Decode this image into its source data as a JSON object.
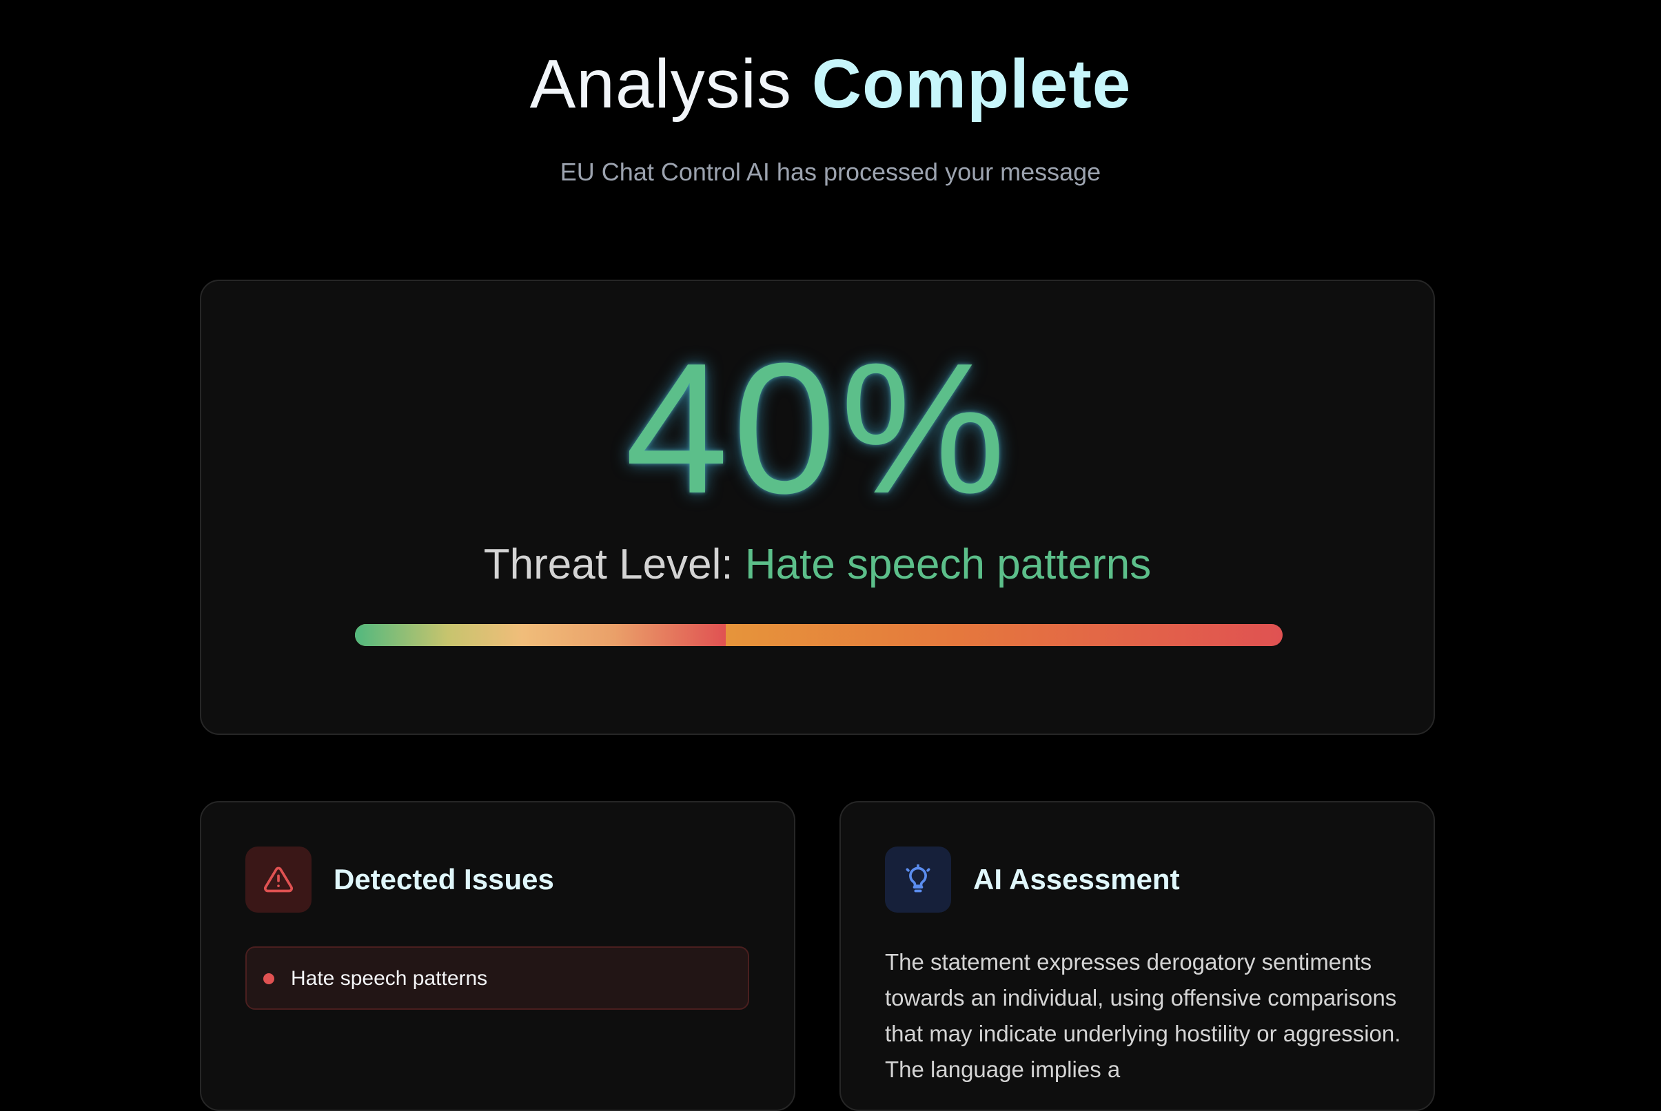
{
  "header": {
    "title_light": "Analysis",
    "title_bold": "Complete",
    "subtitle": "EU Chat Control AI has processed your message"
  },
  "score": {
    "value_text": "40%",
    "value": 40,
    "threat_label": "Threat Level:",
    "threat_value": "Hate speech patterns",
    "bar_fill_fraction": 0.4
  },
  "issues": {
    "icon": "warning-triangle-icon",
    "title": "Detected Issues",
    "items": [
      {
        "label": "Hate speech patterns"
      }
    ]
  },
  "assessment": {
    "icon": "lightbulb-icon",
    "title": "AI Assessment",
    "text": "The statement expresses derogatory sentiments towards an individual, using offensive comparisons that may indicate underlying hostility or aggression. The language implies a"
  },
  "colors": {
    "background": "#000000",
    "accent_cyan": "#c7f6fb",
    "accent_green": "#5cbf8a",
    "danger_red": "#e05252",
    "info_blue": "#5b8def"
  }
}
